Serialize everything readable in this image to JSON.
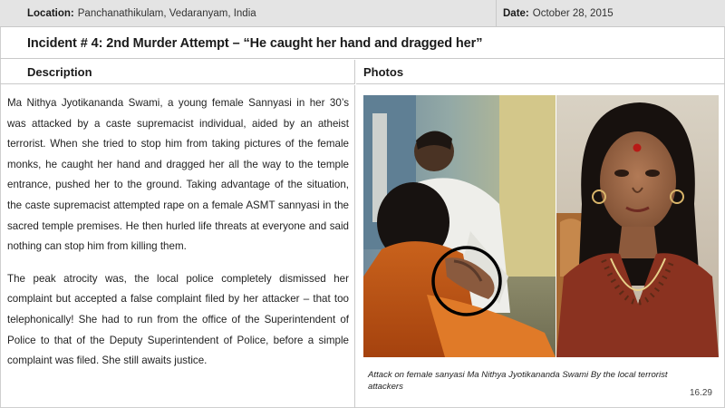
{
  "header": {
    "location_label": "Location:",
    "location_value": "Panchanathikulam, Vedaranyam, India",
    "date_label": "Date:",
    "date_value": "October 28, 2015"
  },
  "incident": {
    "title": "Incident # 4: 2nd Murder Attempt – “He caught her hand and dragged her”"
  },
  "columns": {
    "description": "Description",
    "photos": "Photos"
  },
  "description": {
    "paragraphs": [
      "Ma Nithya Jyotikananda Swami, a young female Sannyasi in her 30’s was attacked by a caste supremacist individual, aided by an atheist terrorist. When she tried to stop him from taking pictures of the female monks, he caught her hand and dragged her all the way to the temple entrance, pushed her to the ground. Taking advantage of the situation, the caste supremacist attempted rape on a female ASMT sannyasi in the sacred temple premises. He then hurled life threats at everyone and said nothing can stop him from killing them.",
      "The peak atrocity was, the local police completely dismissed her complaint but accepted a false complaint filed by her attacker – that too telephonically! She had to run from the office of the Superintendent of Police to that of the Deputy Superintendent of Police, before a simple complaint was filed. She still awaits justice."
    ]
  },
  "photos": {
    "caption": "Attack on female sanyasi Ma Nithya Jyotikananda Swami By the local terrorist attackers",
    "page_number": "16.29"
  }
}
